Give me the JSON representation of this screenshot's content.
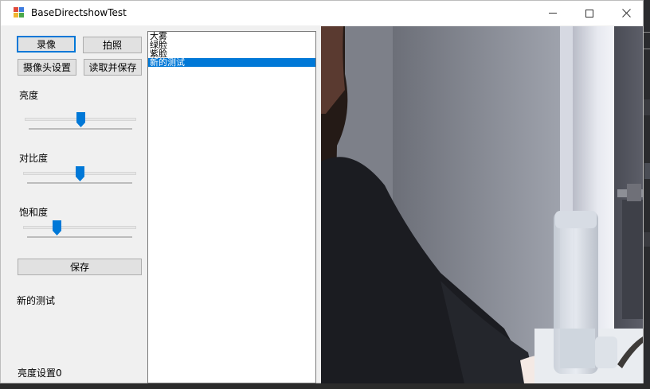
{
  "window": {
    "title": "BaseDirectshowTest"
  },
  "controls": {
    "record_button": "录像",
    "photo_button": "拍照",
    "camera_settings_button": "摄像头设置",
    "read_save_button": "读取并保存",
    "brightness_label": "亮度",
    "contrast_label": "对比度",
    "saturation_label": "饱和度",
    "save_button": "保存",
    "current_preset": "新的测试",
    "status_text": "亮度设置0"
  },
  "sliders": {
    "brightness": 0.5,
    "contrast": 0.5,
    "saturation": 0.28
  },
  "preset_list": {
    "items": [
      "大雾",
      "绿脸",
      "紫脸",
      "新的测试"
    ],
    "selected_index": 3
  },
  "colors": {
    "accent": "#0078d7",
    "window_bg": "#f0f0f0"
  },
  "icons": {
    "minimize": "minimize-icon",
    "maximize": "maximize-icon",
    "close": "close-icon"
  }
}
